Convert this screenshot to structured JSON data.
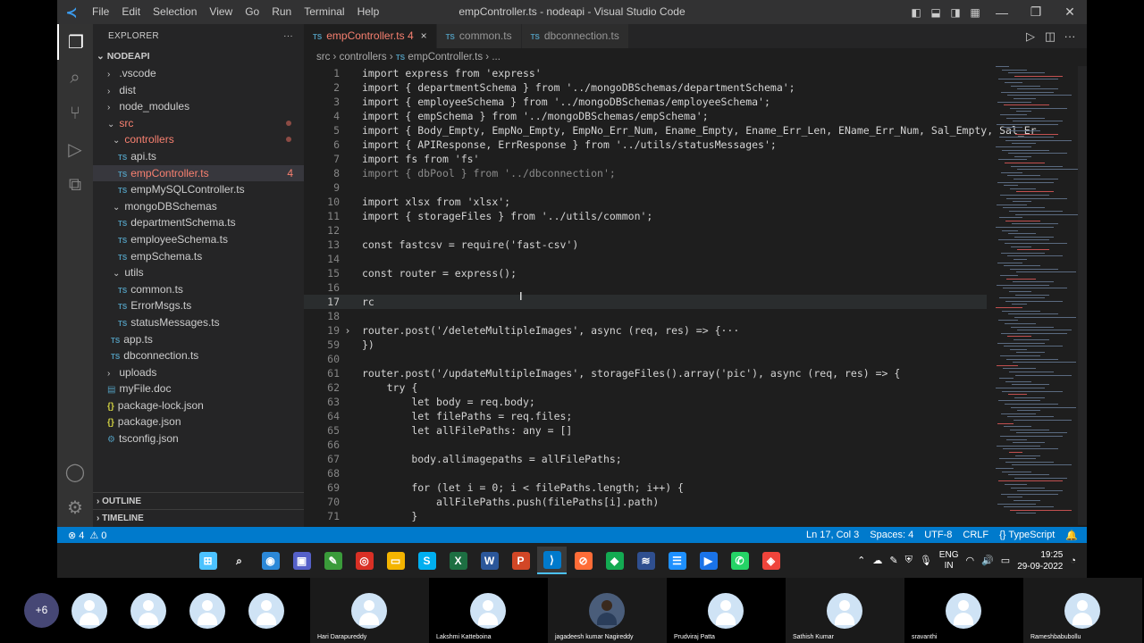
{
  "window": {
    "title": "empController.ts - nodeapi - Visual Studio Code",
    "menu": [
      "File",
      "Edit",
      "Selection",
      "View",
      "Go",
      "Run",
      "Terminal",
      "Help"
    ]
  },
  "sidebar": {
    "header": "EXPLORER",
    "more": "···",
    "root": "NODEAPI",
    "items": [
      {
        "label": ".vscode"
      },
      {
        "label": "dist"
      },
      {
        "label": "node_modules"
      },
      {
        "label": "src"
      },
      {
        "label": "controllers"
      },
      {
        "label": "api.ts"
      },
      {
        "label": "empController.ts",
        "badge": "4"
      },
      {
        "label": "empMySQLController.ts"
      },
      {
        "label": "mongoDBSchemas"
      },
      {
        "label": "departmentSchema.ts"
      },
      {
        "label": "employeeSchema.ts"
      },
      {
        "label": "empSchema.ts"
      },
      {
        "label": "utils"
      },
      {
        "label": "common.ts"
      },
      {
        "label": "ErrorMsgs.ts"
      },
      {
        "label": "statusMessages.ts"
      },
      {
        "label": "app.ts"
      },
      {
        "label": "dbconnection.ts"
      },
      {
        "label": "uploads"
      },
      {
        "label": "myFile.doc"
      },
      {
        "label": "package-lock.json"
      },
      {
        "label": "package.json"
      },
      {
        "label": "tsconfig.json"
      }
    ],
    "outline": "OUTLINE",
    "timeline": "TIMELINE"
  },
  "tabs": [
    {
      "label": "empController.ts",
      "badge": "4",
      "close": "×"
    },
    {
      "label": "common.ts"
    },
    {
      "label": "dbconnection.ts"
    }
  ],
  "file_badge": "TS",
  "breadcrumb": {
    "parts": [
      "src",
      "controllers",
      "empController.ts",
      "..."
    ],
    "sep": "›"
  },
  "code": [
    {
      "n": "1",
      "t": "import express from 'express'"
    },
    {
      "n": "2",
      "t": "import { departmentSchema } from '../mongoDBSchemas/departmentSchema';"
    },
    {
      "n": "3",
      "t": "import { employeeSchema } from '../mongoDBSchemas/employeeSchema';"
    },
    {
      "n": "4",
      "t": "import { empSchema } from '../mongoDBSchemas/empSchema';"
    },
    {
      "n": "5",
      "t": "import { Body_Empty, EmpNo_Empty, EmpNo_Err_Num, Ename_Empty, Ename_Err_Len, EName_Err_Num, Sal_Empty, Sal_Er"
    },
    {
      "n": "6",
      "t": "import { APIResponse, ErrResponse } from '../utils/statusMessages';"
    },
    {
      "n": "7",
      "t": "import fs from 'fs'"
    },
    {
      "n": "8",
      "t": "import { dbPool } from '../dbconnection';"
    },
    {
      "n": "9",
      "t": ""
    },
    {
      "n": "10",
      "t": "import xlsx from 'xlsx';"
    },
    {
      "n": "11",
      "t": "import { storageFiles } from '../utils/common';"
    },
    {
      "n": "12",
      "t": ""
    },
    {
      "n": "13",
      "t": "const fastcsv = require('fast-csv')"
    },
    {
      "n": "14",
      "t": ""
    },
    {
      "n": "15",
      "t": "const router = express();"
    },
    {
      "n": "16",
      "t": ""
    },
    {
      "n": "17",
      "t": "rc"
    },
    {
      "n": "18",
      "t": ""
    },
    {
      "n": "19",
      "t": "router.post('/deleteMultipleImages', async (req, res) => {···"
    },
    {
      "n": "59",
      "t": "})"
    },
    {
      "n": "60",
      "t": ""
    },
    {
      "n": "61",
      "t": "router.post('/updateMultipleImages', storageFiles().array('pic'), async (req, res) => {"
    },
    {
      "n": "62",
      "t": "    try {"
    },
    {
      "n": "63",
      "t": "        let body = req.body;"
    },
    {
      "n": "64",
      "t": "        let filePaths = req.files;"
    },
    {
      "n": "65",
      "t": "        let allFilePaths: any = []"
    },
    {
      "n": "66",
      "t": ""
    },
    {
      "n": "67",
      "t": "        body.allimagepaths = allFilePaths;"
    },
    {
      "n": "68",
      "t": ""
    },
    {
      "n": "69",
      "t": "        for (let i = 0; i < filePaths.length; i++) {"
    },
    {
      "n": "70",
      "t": "            allFilePaths.push(filePaths[i].path)"
    },
    {
      "n": "71",
      "t": "        }"
    }
  ],
  "statusbar": {
    "errors": "⊗ 4",
    "warnings": "⚠ 0",
    "position": "Ln 17, Col 3",
    "spaces": "Spaces: 4",
    "encoding": "UTF-8",
    "eol": "CRLF",
    "language": "{} TypeScript",
    "bell": "🔔"
  },
  "taskbar": {
    "apps": [
      {
        "name": "start",
        "glyph": "⊞",
        "color": "#4cc2ff"
      },
      {
        "name": "search",
        "glyph": "⌕",
        "color": "#202020"
      },
      {
        "name": "widgets",
        "glyph": "◉",
        "color": "#2b88d8"
      },
      {
        "name": "app-store",
        "glyph": "▣",
        "color": "#5560c8"
      },
      {
        "name": "notepad",
        "glyph": "✎",
        "color": "#3a9b3a"
      },
      {
        "name": "chrome",
        "glyph": "◎",
        "color": "#d93025"
      },
      {
        "name": "file-explorer",
        "glyph": "▭",
        "color": "#f4b400"
      },
      {
        "name": "skype",
        "glyph": "S",
        "color": "#00aff0"
      },
      {
        "name": "excel",
        "glyph": "X",
        "color": "#1d6f42"
      },
      {
        "name": "word",
        "glyph": "W",
        "color": "#2b579a"
      },
      {
        "name": "powerpoint",
        "glyph": "P",
        "color": "#d24726"
      },
      {
        "name": "vscode",
        "glyph": "⟩",
        "color": "#007acc"
      },
      {
        "name": "postman",
        "glyph": "⊘",
        "color": "#ff6c37"
      },
      {
        "name": "mongodb-compass",
        "glyph": "◆",
        "color": "#13aa52"
      },
      {
        "name": "app-blue",
        "glyph": "≋",
        "color": "#2f4f8f"
      },
      {
        "name": "notes",
        "glyph": "☰",
        "color": "#1e90ff"
      },
      {
        "name": "video-app",
        "glyph": "▶",
        "color": "#1a73e8"
      },
      {
        "name": "whatsapp",
        "glyph": "✆",
        "color": "#25d366"
      },
      {
        "name": "anydesk",
        "glyph": "◈",
        "color": "#ef443b"
      }
    ],
    "tray": {
      "lang_top": "ENG",
      "lang_bottom": "IN",
      "time": "19:25",
      "date": "29-09-2022"
    }
  },
  "meeting": {
    "more": "+6",
    "participants": [
      "",
      "",
      "",
      "",
      "Hari Darapureddy",
      "Lakshmi Katteboina",
      "jagadeesh kumar Nagireddy",
      "Prudviraj Patta",
      "Sathish Kumar",
      "sravanthi",
      "Rameshbabubollu"
    ]
  }
}
